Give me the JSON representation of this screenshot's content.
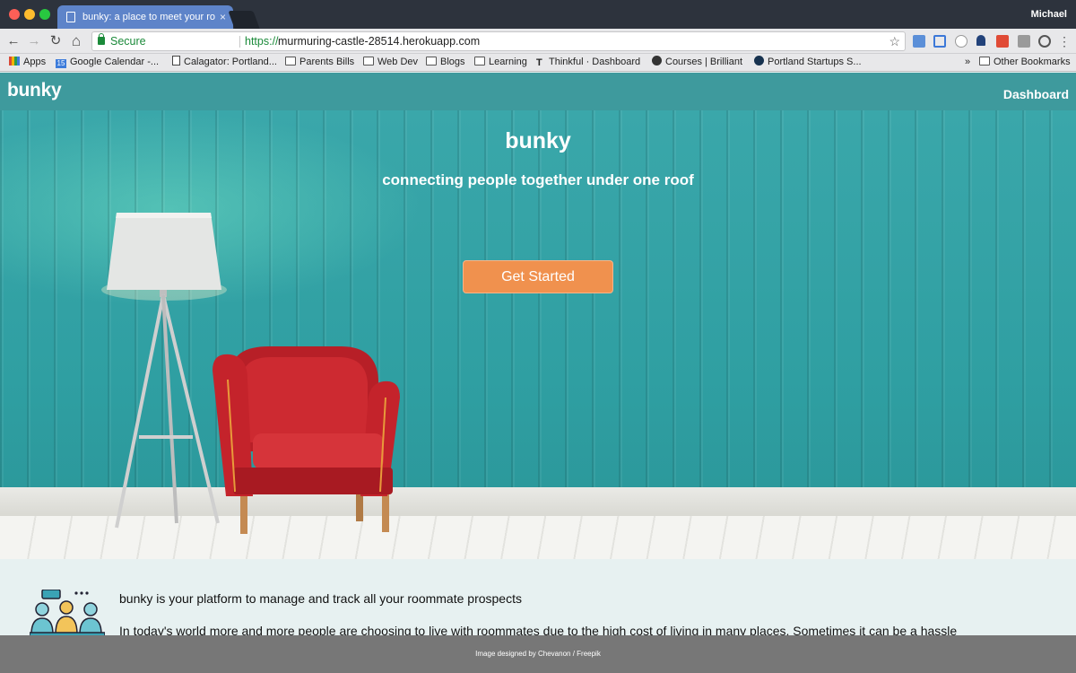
{
  "browser": {
    "tab_title": "bunky: a place to meet your ro",
    "tab_close": "×",
    "profile": "Michael",
    "secure_label": "Secure",
    "url_scheme": "https://",
    "url_host": "murmuring-castle-28514.herokuapp.com",
    "nav": {
      "back": "←",
      "forward": "→",
      "reload": "↻",
      "home": "⌂"
    },
    "star": "☆",
    "bookmarks": [
      {
        "label": "Apps",
        "icon": "apps-grid-icon"
      },
      {
        "label": "Google Calendar -...",
        "icon": "calendar-icon",
        "icon_text": "15"
      },
      {
        "label": "Calagator: Portland...",
        "icon": "page-icon"
      },
      {
        "label": "Parents Bills",
        "icon": "folder-icon"
      },
      {
        "label": "Web Dev",
        "icon": "folder-icon"
      },
      {
        "label": "Blogs",
        "icon": "folder-icon"
      },
      {
        "label": "Learning",
        "icon": "folder-icon"
      },
      {
        "label": "Thinkful · Dashboard",
        "icon": "thinkful-icon"
      },
      {
        "label": "Courses | Brilliant",
        "icon": "brilliant-icon"
      },
      {
        "label": "Portland Startups S...",
        "icon": "startups-icon"
      }
    ],
    "overflow": "»",
    "other_bookmarks": "Other Bookmarks"
  },
  "site": {
    "brand": "bunky",
    "nav_dashboard": "Dashboard"
  },
  "hero": {
    "title": "bunky",
    "subtitle": "connecting people together under one roof",
    "cta": "Get Started"
  },
  "content": {
    "tagline": "bunky is your platform to manage and track all your roommate prospects",
    "paragraph": "In today's world more and more people are choosing to live with roommates due to the high cost of living in many places. Sometimes it can be a hassle"
  },
  "footer": {
    "credit": "Image designed by Chevanon / Freepik"
  },
  "colors": {
    "navbar": "#3e9a9d",
    "wall": "#2f9fa2",
    "cta": "#f0914e",
    "chair": "#c8232a",
    "footer": "#777777"
  }
}
